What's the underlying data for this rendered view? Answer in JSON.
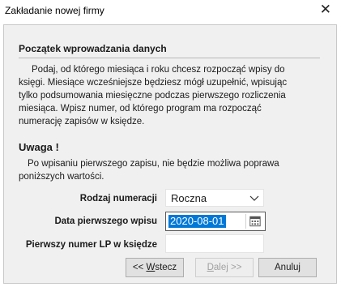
{
  "window": {
    "title": "Zakładanie nowej firmy",
    "close_glyph": "✕"
  },
  "intro": {
    "heading": "Początek wprowadzania danych",
    "lines": [
      "Podaj, od którego miesiąca i roku chcesz rozpocząć wpisy do",
      "księgi. Miesiące wcześniejsze będziesz mógł uzupełnić, wpisując",
      "tylko podsumowania miesięczne podczas pierwszego rozliczenia",
      "miesiąca. Wpisz numer, od którego program ma rozpocząć",
      "numerację zapisów w księdze."
    ]
  },
  "warning": {
    "heading": "Uwaga !",
    "lines": [
      "Po wpisaniu pierwszego zapisu, nie będzie możliwa poprawa",
      "poniższych wartości."
    ]
  },
  "form": {
    "numbering_label": "Rodzaj numeracji",
    "numbering_value": "Roczna",
    "date_label": "Data pierwszego wpisu",
    "date_value": "2020-08-01",
    "lp_label": "Pierwszy numer LP w księdze",
    "lp_value": ""
  },
  "buttons": {
    "back_prefix": "<< ",
    "back_accel": "W",
    "back_rest": "stecz",
    "next_prefix": "",
    "next_accel": "D",
    "next_rest": "alej >>",
    "cancel_label": "Anuluj"
  },
  "icons": {
    "close": "close-icon",
    "dropdown": "chevron-down-icon",
    "calendar": "calendar-icon"
  },
  "colors": {
    "selection": "#0078d7",
    "panel": "#f0f0f0",
    "disabled_text": "#a0a0a0"
  }
}
